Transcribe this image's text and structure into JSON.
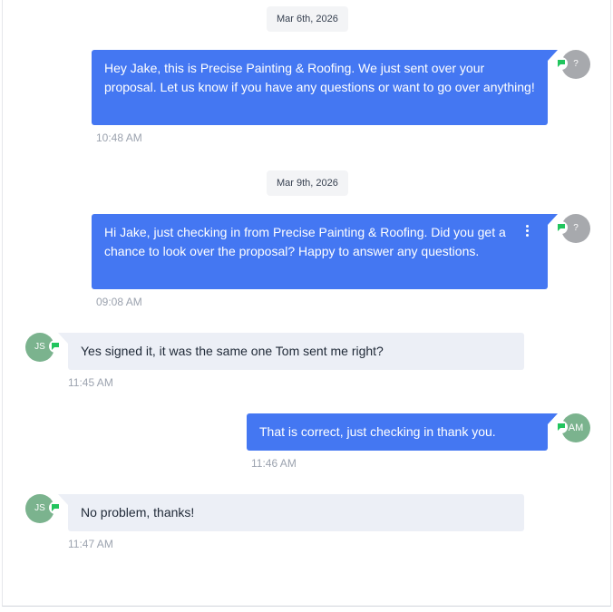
{
  "conversation": {
    "dates": [
      "Mar 6th, 2026",
      "Mar 9th, 2026"
    ],
    "messages": [
      {
        "direction": "outbound",
        "text": "Hey Jake, this is Precise Painting & Roofing. We just sent over your proposal. Let us know if you have any questions or want to go over anything!",
        "time": "10:48 AM",
        "avatar": "?",
        "channel_icon": "sms-icon"
      },
      {
        "direction": "outbound",
        "text": "Hi Jake, just checking in from Precise Painting & Roofing. Did you get a chance to look over the proposal? Happy to answer any questions.",
        "time": "09:08 AM",
        "avatar": "?",
        "channel_icon": "sms-icon"
      },
      {
        "direction": "inbound",
        "text": "Yes signed it, it was the same one Tom sent me right?",
        "time": "11:45 AM",
        "avatar": "JS",
        "channel_icon": "sms-icon"
      },
      {
        "direction": "outbound",
        "text": "That is correct, just checking in thank you.",
        "time": "11:46 AM",
        "avatar": "AM",
        "channel_icon": "sms-icon"
      },
      {
        "direction": "inbound",
        "text": "No problem, thanks!",
        "time": "11:47 AM",
        "avatar": "JS",
        "channel_icon": "sms-icon"
      }
    ]
  },
  "colors": {
    "outbound_bubble": "#4477f2",
    "inbound_bubble": "#eceff6",
    "avatar_unknown": "#a7a9ad",
    "avatar_known": "#7bb38e",
    "channel_badge": "#22c55e"
  }
}
